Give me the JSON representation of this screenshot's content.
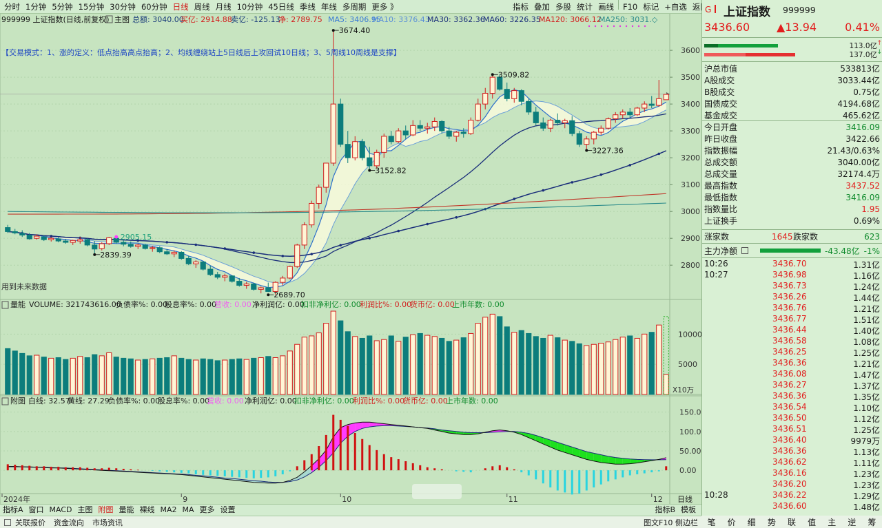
{
  "toolbar": {
    "left": [
      "分时",
      "1分钟",
      "5分钟",
      "15分钟",
      "30分钟",
      "60分钟",
      "日线",
      "周线",
      "月线",
      "10分钟",
      "45日线",
      "季线",
      "年线",
      "多周期",
      "更多 》"
    ],
    "active_index": 6,
    "right": [
      "指标",
      "叠加",
      "多股",
      "统计",
      "画线",
      "F10",
      "标记",
      "+自选",
      "返回"
    ]
  },
  "chart_header": {
    "symbol_line": "999999 上证指数(日线,前复权)",
    "main_label": "主图",
    "amount": "总额: 3040.00",
    "buy": "买亿: 2914.88",
    "sell": "卖亿: -125.13",
    "net": "净: 2789.75",
    "ma": [
      {
        "label": "MA5: 3406.95",
        "color": "#3a7bd5"
      },
      {
        "label": "MA10: 3376.43",
        "color": "#5a8fd8"
      },
      {
        "label": "MA30: 3362.36",
        "color": "#1a2e7a"
      },
      {
        "label": "MA60: 3226.35",
        "color": "#1a2e7a"
      },
      {
        "label": "MA120: 3066.12",
        "color": "#d21c1c"
      },
      {
        "label": "MA250: 3031.◇",
        "color": "#2a8a8a"
      }
    ],
    "trade_mode": "【交易模式：1、涨的定义：低点抬高高点抬高；2、均线缠绕站上5日线后上攻回试10日线；3、5周线10周线是支撑】",
    "future_data": "用到未来数据"
  },
  "colors": {
    "up": "#d21c1c",
    "down": "#0c7d7c",
    "ma5": "#3a7bd5",
    "ma30": "#1a2e7a",
    "ma120": "#c0392b",
    "ma250": "#2a8a8a",
    "macd_green": "#1ee01e",
    "macd_magenta": "#ff3cff",
    "macd_cyan": "#28d4e0"
  },
  "annotations": {
    "high1": "3674.40",
    "high2": "3509.82",
    "low1": "3152.82",
    "low2": "3227.36",
    "low3": "2689.70",
    "low4": "2839.39",
    "high3": "2905.15"
  },
  "volume_header": {
    "label": "量能",
    "items": [
      "VOLUME: 321743616.00",
      "负债率%: 0.00",
      "股息率%: 0.00",
      "营收: 0.00",
      "净利润亿: 0.00",
      "扣非净利亿: 0.00",
      "利润比%: 0.00",
      "货币亿: 0.00",
      "上市年数: 0.00"
    ]
  },
  "volume_unit": "X10万",
  "macd_header": {
    "label": "附图",
    "items": [
      "白线: 32.57",
      "黄线: 27.29",
      "负债率%: 0.00",
      "股息率%: 0.00",
      "营收: 0.00",
      "净利润亿: 0.00",
      "扣非净利亿: 0.00",
      "利润比%: 0.00",
      "货币亿: 0.00",
      "上市年数: 0.00"
    ]
  },
  "x_labels": [
    "2024年",
    "9",
    "10",
    "11",
    "12"
  ],
  "period_label": "日线",
  "chart_data": {
    "type": "candlestick",
    "price_axis": {
      "ticks": [
        2800,
        2900,
        3000,
        3100,
        3200,
        3300,
        3400,
        3500,
        3600
      ],
      "range": [
        2680,
        3690
      ],
      "current": 3436.6
    },
    "volume_axis": {
      "ticks": [
        5000,
        10000
      ],
      "range": [
        0,
        13800
      ]
    },
    "macd_axis": {
      "ticks": [
        0.0,
        50.0,
        100.0,
        150.0
      ],
      "range": [
        -60,
        160
      ]
    },
    "candles": [
      [
        2940,
        2950,
        2920,
        2925
      ],
      [
        2925,
        2935,
        2915,
        2920
      ],
      [
        2918,
        2930,
        2905,
        2912
      ],
      [
        2912,
        2920,
        2895,
        2898
      ],
      [
        2900,
        2915,
        2895,
        2908
      ],
      [
        2905,
        2912,
        2890,
        2895
      ],
      [
        2895,
        2905,
        2888,
        2900
      ],
      [
        2898,
        2906,
        2885,
        2890
      ],
      [
        2890,
        2898,
        2880,
        2885
      ],
      [
        2885,
        2895,
        2875,
        2892
      ],
      [
        2890,
        2905,
        2880,
        2895
      ],
      [
        2895,
        2900,
        2870,
        2875
      ],
      [
        2875,
        2890,
        2839,
        2860
      ],
      [
        2862,
        2885,
        2855,
        2880
      ],
      [
        2880,
        2905,
        2875,
        2902
      ],
      [
        2900,
        2910,
        2880,
        2885
      ],
      [
        2885,
        2895,
        2870,
        2878
      ],
      [
        2878,
        2888,
        2865,
        2870
      ],
      [
        2870,
        2880,
        2860,
        2875
      ],
      [
        2875,
        2880,
        2858,
        2862
      ],
      [
        2862,
        2872,
        2850,
        2865
      ],
      [
        2865,
        2870,
        2845,
        2850
      ],
      [
        2850,
        2860,
        2838,
        2842
      ],
      [
        2842,
        2855,
        2830,
        2848
      ],
      [
        2848,
        2852,
        2820,
        2825
      ],
      [
        2825,
        2835,
        2800,
        2805
      ],
      [
        2805,
        2818,
        2790,
        2812
      ],
      [
        2812,
        2815,
        2780,
        2785
      ],
      [
        2785,
        2798,
        2760,
        2765
      ],
      [
        2765,
        2775,
        2748,
        2755
      ],
      [
        2755,
        2768,
        2740,
        2760
      ],
      [
        2760,
        2762,
        2735,
        2740
      ],
      [
        2740,
        2752,
        2720,
        2725
      ],
      [
        2725,
        2738,
        2712,
        2730
      ],
      [
        2730,
        2735,
        2705,
        2710
      ],
      [
        2710,
        2720,
        2695,
        2716
      ],
      [
        2716,
        2735,
        2700,
        2702
      ],
      [
        2702,
        2740,
        2690,
        2736
      ],
      [
        2736,
        2760,
        2725,
        2752
      ],
      [
        2752,
        2798,
        2748,
        2795
      ],
      [
        2795,
        2880,
        2790,
        2875
      ],
      [
        2875,
        2960,
        2860,
        2950
      ],
      [
        2950,
        3040,
        2940,
        3030
      ],
      [
        3030,
        3100,
        3010,
        3090
      ],
      [
        3090,
        3180,
        3070,
        3180
      ],
      [
        3180,
        3674,
        3170,
        3400
      ],
      [
        3400,
        3420,
        3240,
        3250
      ],
      [
        3250,
        3300,
        3180,
        3200
      ],
      [
        3200,
        3280,
        3190,
        3260
      ],
      [
        3260,
        3270,
        3190,
        3200
      ],
      [
        3200,
        3240,
        3150,
        3170
      ],
      [
        3170,
        3230,
        3160,
        3220
      ],
      [
        3220,
        3290,
        3200,
        3280
      ],
      [
        3280,
        3300,
        3250,
        3260
      ],
      [
        3260,
        3310,
        3255,
        3300
      ],
      [
        3300,
        3320,
        3270,
        3285
      ],
      [
        3285,
        3340,
        3280,
        3320
      ],
      [
        3320,
        3340,
        3300,
        3310
      ],
      [
        3310,
        3330,
        3290,
        3315
      ],
      [
        3315,
        3350,
        3300,
        3335
      ],
      [
        3335,
        3340,
        3290,
        3300
      ],
      [
        3300,
        3315,
        3270,
        3280
      ],
      [
        3280,
        3300,
        3260,
        3295
      ],
      [
        3295,
        3310,
        3275,
        3290
      ],
      [
        3290,
        3350,
        3285,
        3340
      ],
      [
        3340,
        3420,
        3335,
        3400
      ],
      [
        3400,
        3460,
        3380,
        3440
      ],
      [
        3440,
        3510,
        3420,
        3500
      ],
      [
        3500,
        3509,
        3450,
        3455
      ],
      [
        3455,
        3480,
        3410,
        3420
      ],
      [
        3420,
        3460,
        3405,
        3450
      ],
      [
        3450,
        3455,
        3395,
        3410
      ],
      [
        3410,
        3420,
        3360,
        3370
      ],
      [
        3370,
        3390,
        3320,
        3330
      ],
      [
        3330,
        3350,
        3300,
        3310
      ],
      [
        3310,
        3345,
        3295,
        3340
      ],
      [
        3340,
        3365,
        3320,
        3330
      ],
      [
        3330,
        3345,
        3310,
        3338
      ],
      [
        3338,
        3355,
        3280,
        3290
      ],
      [
        3290,
        3300,
        3240,
        3250
      ],
      [
        3250,
        3280,
        3227,
        3270
      ],
      [
        3270,
        3300,
        3250,
        3295
      ],
      [
        3295,
        3320,
        3285,
        3310
      ],
      [
        3310,
        3350,
        3305,
        3345
      ],
      [
        3345,
        3370,
        3330,
        3360
      ],
      [
        3360,
        3380,
        3345,
        3370
      ],
      [
        3370,
        3385,
        3350,
        3360
      ],
      [
        3360,
        3390,
        3355,
        3385
      ],
      [
        3385,
        3410,
        3370,
        3400
      ],
      [
        3400,
        3430,
        3385,
        3395
      ],
      [
        3395,
        3490,
        3390,
        3420
      ],
      [
        3416,
        3437,
        3416,
        3436
      ]
    ],
    "volumes": [
      7600,
      7200,
      6800,
      6400,
      6500,
      6200,
      6000,
      6100,
      5800,
      6000,
      6300,
      6100,
      6600,
      6400,
      6900,
      6200,
      6000,
      5900,
      5700,
      5800,
      5900,
      6000,
      6100,
      6400,
      6000,
      5800,
      5700,
      5900,
      5800,
      5600,
      5700,
      5800,
      5900,
      5800,
      6000,
      6100,
      6300,
      6100,
      6400,
      7200,
      8300,
      9500,
      9700,
      10200,
      11800,
      13800,
      12200,
      10400,
      9600,
      9300,
      9700,
      8900,
      9100,
      9700,
      8800,
      9500,
      9900,
      10100,
      9800,
      9600,
      9300,
      8800,
      9000,
      9400,
      10100,
      11800,
      12800,
      13300,
      12900,
      11200,
      10300,
      10600,
      10100,
      9600,
      9300,
      9800,
      9400,
      9000,
      8800,
      8400,
      8100,
      8300,
      8500,
      8700,
      9100,
      9500,
      9700,
      9300,
      10000,
      10300,
      11500,
      3300
    ],
    "macd_hist": [
      12,
      11,
      10,
      9,
      8,
      8,
      7,
      7,
      6,
      6,
      6,
      5,
      4,
      4,
      5,
      4,
      3,
      2,
      1,
      0,
      -1,
      -2,
      -3,
      -4,
      -5,
      -6,
      -8,
      -9,
      -10,
      -11,
      -12,
      -13,
      -14,
      -15,
      -16,
      -15,
      -14,
      -12,
      -8,
      -2,
      8,
      20,
      32,
      48,
      70,
      110,
      100,
      88,
      74,
      62,
      50,
      40,
      32,
      26,
      22,
      18,
      14,
      10,
      6,
      4,
      2,
      0,
      -2,
      -3,
      -4,
      0,
      4,
      8,
      10,
      6,
      2,
      -4,
      -10,
      -18,
      -26,
      -34,
      -40,
      -44,
      -48,
      -46,
      -40,
      -34,
      -28,
      -22,
      -18,
      -14,
      -10,
      -8,
      -6,
      -4,
      -2,
      8
    ],
    "macd_white": [
      10,
      10,
      9,
      9,
      8,
      7,
      6,
      6,
      5,
      4,
      3,
      2,
      1,
      0,
      -1,
      -2,
      -3,
      -4,
      -5,
      -6,
      -7,
      -8,
      -9,
      -10,
      -11,
      -13,
      -15,
      -17,
      -19,
      -21,
      -23,
      -25,
      -27,
      -29,
      -31,
      -32,
      -33,
      -33,
      -31,
      -26,
      -18,
      -4,
      12,
      30,
      52,
      86,
      110,
      118,
      122,
      124,
      124,
      122,
      120,
      118,
      116,
      114,
      112,
      110,
      108,
      104,
      100,
      96,
      94,
      92,
      92,
      94,
      98,
      102,
      104,
      102,
      98,
      92,
      84,
      76,
      68,
      60,
      52,
      46,
      40,
      34,
      28,
      24,
      20,
      18,
      16,
      16,
      17,
      19,
      22,
      25,
      28,
      32.57
    ],
    "macd_yellow": [
      9,
      9,
      9,
      8,
      8,
      8,
      7,
      6,
      6,
      5,
      4,
      3,
      2,
      1,
      0,
      -1,
      -2,
      -3,
      -4,
      -5,
      -6,
      -7,
      -8,
      -9,
      -10,
      -11,
      -13,
      -14,
      -16,
      -18,
      -20,
      -21,
      -23,
      -25,
      -27,
      -28,
      -30,
      -31,
      -31,
      -29,
      -25,
      -17,
      -6,
      8,
      25,
      45,
      70,
      88,
      100,
      108,
      112,
      114,
      115,
      115,
      114,
      113,
      112,
      110,
      109,
      107,
      104,
      102,
      100,
      98,
      97,
      97,
      97,
      98,
      99,
      100,
      100,
      98,
      95,
      90,
      84,
      78,
      72,
      66,
      60,
      54,
      48,
      44,
      40,
      36,
      33,
      31,
      29,
      28,
      27.5,
      27.2,
      27.1,
      27.29
    ]
  },
  "right_panel": {
    "marker": "G",
    "title": "上证指数",
    "code": "999999",
    "price": "3436.60",
    "change": "▲13.94",
    "pct": "0.41%",
    "flow_in": "113.0亿",
    "flow_out": "137.0亿",
    "stats": [
      {
        "label": "沪总市值",
        "value": "533813亿",
        "color": "#1a1a1a"
      },
      {
        "label": "A股成交",
        "value": "3033.44亿",
        "color": "#1a1a1a"
      },
      {
        "label": "B股成交",
        "value": "0.75亿",
        "color": "#1a1a1a"
      },
      {
        "label": "国债成交",
        "value": "4194.68亿",
        "color": "#1a1a1a"
      },
      {
        "label": "基金成交",
        "value": "465.62亿",
        "color": "#1a1a1a"
      },
      {
        "label": "今日开盘",
        "value": "3416.09",
        "color": "#0f8a2c"
      },
      {
        "label": "昨日收盘",
        "value": "3422.66",
        "color": "#1a1a1a"
      },
      {
        "label": "指数振幅",
        "value": "21.43/0.63%",
        "color": "#1a1a1a"
      },
      {
        "label": "总成交额",
        "value": "3040.00亿",
        "color": "#1a1a1a"
      },
      {
        "label": "总成交量",
        "value": "32174.4万",
        "color": "#1a1a1a"
      },
      {
        "label": "最高指数",
        "value": "3437.52",
        "color": "#e21d1d"
      },
      {
        "label": "最低指数",
        "value": "3416.09",
        "color": "#0f8a2c"
      },
      {
        "label": "指数量比",
        "value": "1.95",
        "color": "#e21d1d"
      },
      {
        "label": "上证换手",
        "value": "0.69%",
        "color": "#1a1a1a"
      }
    ],
    "rise_label": "涨家数",
    "rise_value": "1645",
    "fall_label": "跌家数",
    "fall_value": "623",
    "main_net_label": "主力净额",
    "main_net_value": "-43.48亿",
    "main_net_pct": "-1%",
    "ticks": [
      {
        "t": "10:26",
        "p": "3436.70",
        "v": "1.31亿"
      },
      {
        "t": "10:27",
        "p": "3436.98",
        "v": "1.16亿"
      },
      {
        "t": "",
        "p": "3436.73",
        "v": "1.24亿"
      },
      {
        "t": "",
        "p": "3436.26",
        "v": "1.44亿"
      },
      {
        "t": "",
        "p": "3436.76",
        "v": "1.21亿"
      },
      {
        "t": "",
        "p": "3436.77",
        "v": "1.51亿"
      },
      {
        "t": "",
        "p": "3436.44",
        "v": "1.40亿"
      },
      {
        "t": "",
        "p": "3436.58",
        "v": "1.08亿"
      },
      {
        "t": "",
        "p": "3436.25",
        "v": "1.25亿"
      },
      {
        "t": "",
        "p": "3436.36",
        "v": "1.21亿"
      },
      {
        "t": "",
        "p": "3436.08",
        "v": "1.47亿"
      },
      {
        "t": "",
        "p": "3436.27",
        "v": "1.37亿"
      },
      {
        "t": "",
        "p": "3436.36",
        "v": "1.35亿"
      },
      {
        "t": "",
        "p": "3436.54",
        "v": "1.10亿"
      },
      {
        "t": "",
        "p": "3436.50",
        "v": "1.12亿"
      },
      {
        "t": "",
        "p": "3436.51",
        "v": "1.25亿"
      },
      {
        "t": "",
        "p": "3436.40",
        "v": "9979万"
      },
      {
        "t": "",
        "p": "3436.36",
        "v": "1.13亿"
      },
      {
        "t": "",
        "p": "3436.62",
        "v": "1.11亿"
      },
      {
        "t": "",
        "p": "3436.16",
        "v": "1.23亿"
      },
      {
        "t": "",
        "p": "3436.20",
        "v": "1.23亿"
      },
      {
        "t": "10:28",
        "p": "3436.22",
        "v": "1.29亿"
      },
      {
        "t": "",
        "p": "3436.60",
        "v": "1.48亿"
      }
    ],
    "tabs": [
      "笔",
      "价",
      "细",
      "势",
      "联",
      "值",
      "主",
      "逆",
      "筹"
    ]
  },
  "bottom_tabs": {
    "left": [
      "指标A",
      "窗口",
      "MACD",
      "主图",
      "附图",
      "量能",
      "裸线",
      "MA2",
      "MA",
      "更多",
      "设置"
    ],
    "active": 4,
    "right": [
      "指标B",
      "模板"
    ]
  },
  "statusbar": {
    "items": [
      "关联报价",
      "资金流向",
      "市场资讯"
    ],
    "right": "图文F10 侧边栏《"
  }
}
